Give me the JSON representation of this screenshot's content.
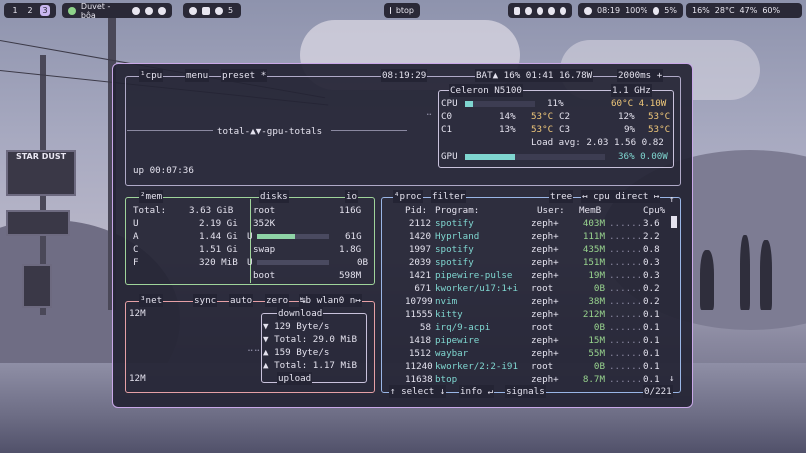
{
  "topbar": {
    "workspaces": [
      "1",
      "2",
      "3"
    ],
    "active_workspace": "3",
    "media_title": "Duvet - bôa",
    "tray_count": "5",
    "window_title": "btop",
    "clock": "08:19",
    "volume": "100%",
    "brightness": "5%",
    "cpu": "16%",
    "temp": "28°C",
    "memory": "47%",
    "battery": "60%"
  },
  "cpu_panel": {
    "title_num": "¹",
    "title": "cpu",
    "menu": "menu",
    "preset": "preset *",
    "clock": "08:19:29",
    "battery": "BAT▲ 16% 01:41 16.78W",
    "interval": "2000ms +",
    "graph_label": "total-▲▼-gpu-totals",
    "uptime": "up 00:07:36",
    "model": "Celeron N5100",
    "freq": "1.1 GHz",
    "cpu_label": "CPU",
    "cpu_pct": "11%",
    "cpu_temp": "60°C 4.10W",
    "cpu_fill": 0.11,
    "cores": [
      {
        "name": "C0",
        "pct": "14%",
        "temp": "53°C"
      },
      {
        "name": "C1",
        "pct": "13%",
        "temp": "53°C"
      },
      {
        "name": "C2",
        "pct": "12%",
        "temp": "53°C"
      },
      {
        "name": "C3",
        "pct": "9%",
        "temp": "53°C"
      }
    ],
    "load": "Load avg: 2.03 1.56 0.82",
    "gpu_label": "GPU",
    "gpu_pct": "36% 0.00W",
    "gpu_fill": 0.36
  },
  "mem_panel": {
    "title": "²mem",
    "total_label": "Total:",
    "total": "3.63 GiB",
    "rows": [
      {
        "k": "U",
        "v": "2.19 Gi"
      },
      {
        "k": "A",
        "v": "1.44 Gi"
      },
      {
        "k": "C",
        "v": "1.51 Gi"
      },
      {
        "k": "F",
        "v": "320 MiB"
      }
    ],
    "disks_title": "disks",
    "io": "io",
    "root_label": "root",
    "root_size": "116G",
    "root_io": "352K",
    "root_used_label": "U",
    "root_used": "61G",
    "root_fill": 0.53,
    "swap_label": "swap",
    "swap_size": "1.8G",
    "swap_used_label": "U",
    "swap_used": "0B",
    "boot_label": "boot",
    "boot_size": "598M"
  },
  "net_panel": {
    "title": "³net",
    "sync": "sync",
    "auto": "auto",
    "zero": "zero",
    "iface": "↹b wlan0 n↦",
    "top_scale": "12M",
    "bottom_scale": "12M",
    "download": "download",
    "dl_rate": "▼ 129 Byte/s",
    "dl_total": "▼ Total: 29.0 MiB",
    "ul_rate": "▲ 159 Byte/s",
    "ul_total": "▲ Total: 1.17 MiB",
    "upload": "upload"
  },
  "proc_panel": {
    "title": "⁴proc",
    "filter": "filter",
    "tree": "tree",
    "sort": "↤ cpu direct ↦",
    "headers": {
      "pid": "Pid:",
      "program": "Program:",
      "user": "User:",
      "mem": "MemB",
      "cpu": "Cpu%"
    },
    "rows": [
      {
        "pid": "2112",
        "program": "spotify",
        "user": "zeph+",
        "mem": "403M",
        "cpu": "3.6"
      },
      {
        "pid": "1420",
        "program": "Hyprland",
        "user": "zeph+",
        "mem": "111M",
        "cpu": "2.2"
      },
      {
        "pid": "1997",
        "program": "spotify",
        "user": "zeph+",
        "mem": "435M",
        "cpu": "0.8"
      },
      {
        "pid": "2039",
        "program": "spotify",
        "user": "zeph+",
        "mem": "151M",
        "cpu": "0.3"
      },
      {
        "pid": "1421",
        "program": "pipewire-pulse",
        "user": "zeph+",
        "mem": "19M",
        "cpu": "0.3"
      },
      {
        "pid": "671",
        "program": "kworker/u17:1+i",
        "user": "root",
        "mem": "0B",
        "cpu": "0.2"
      },
      {
        "pid": "10799",
        "program": "nvim",
        "user": "zeph+",
        "mem": "38M",
        "cpu": "0.2"
      },
      {
        "pid": "11555",
        "program": "kitty",
        "user": "zeph+",
        "mem": "212M",
        "cpu": "0.1"
      },
      {
        "pid": "58",
        "program": "irq/9-acpi",
        "user": "root",
        "mem": "0B",
        "cpu": "0.1"
      },
      {
        "pid": "1418",
        "program": "pipewire",
        "user": "zeph+",
        "mem": "15M",
        "cpu": "0.1"
      },
      {
        "pid": "1512",
        "program": "waybar",
        "user": "zeph+",
        "mem": "55M",
        "cpu": "0.1"
      },
      {
        "pid": "11240",
        "program": "kworker/2:2-i91",
        "user": "root",
        "mem": "0B",
        "cpu": "0.1"
      },
      {
        "pid": "11638",
        "program": "btop",
        "user": "zeph+",
        "mem": "8.7M",
        "cpu": "0.1"
      }
    ],
    "select": "↑ select ↓",
    "info": "info ↵",
    "signals": "signals",
    "count": "0/221"
  }
}
